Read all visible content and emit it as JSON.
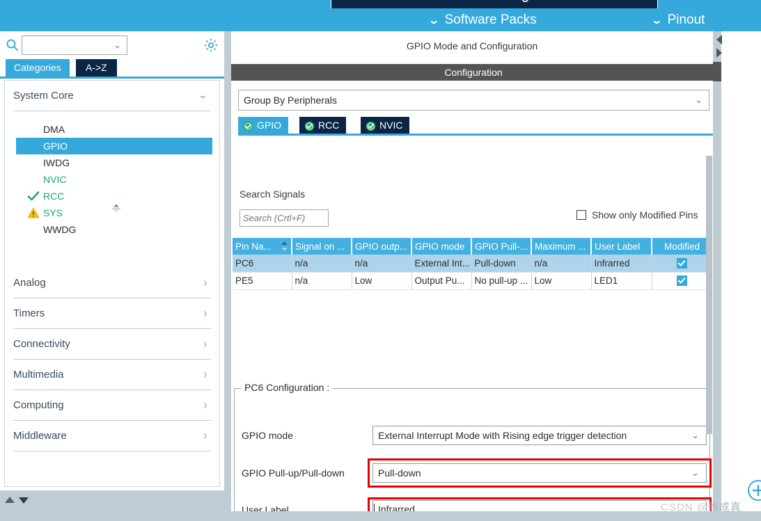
{
  "topnav": {
    "software_packs": "Software Packs",
    "pinout": "Pinout",
    "chevron": "⌄"
  },
  "left_panel": {
    "search": {
      "value": "",
      "placeholder": ""
    },
    "gear_tooltip": "Settings",
    "tabs": [
      {
        "id": "categories",
        "label": "Categories",
        "active": true
      },
      {
        "id": "a-to-z",
        "label": "A->Z",
        "active": false
      }
    ],
    "categories": [
      {
        "label": "System Core",
        "expanded": true,
        "arrow": "⌄"
      },
      {
        "label": "Analog",
        "expanded": false,
        "arrow": "›"
      },
      {
        "label": "Timers",
        "expanded": false,
        "arrow": "›"
      },
      {
        "label": "Connectivity",
        "expanded": false,
        "arrow": "›"
      },
      {
        "label": "Multimedia",
        "expanded": false,
        "arrow": "›"
      },
      {
        "label": "Computing",
        "expanded": false,
        "arrow": "›"
      },
      {
        "label": "Middleware",
        "expanded": false,
        "arrow": "›"
      }
    ],
    "system_core_items": [
      {
        "label": "DMA",
        "state": "none",
        "selected": false
      },
      {
        "label": "GPIO",
        "state": "none",
        "selected": true
      },
      {
        "label": "IWDG",
        "state": "none",
        "selected": false
      },
      {
        "label": "NVIC",
        "state": "green",
        "selected": false
      },
      {
        "label": "RCC",
        "state": "check",
        "selected": false
      },
      {
        "label": "SYS",
        "state": "warning",
        "selected": false
      },
      {
        "label": "WWDG",
        "state": "none",
        "selected": false
      }
    ]
  },
  "main": {
    "mode_title": "GPIO Mode and Configuration",
    "configuration_title": "Configuration",
    "group_by": {
      "value": "Group By Peripherals",
      "caret": "⌄"
    },
    "peripheral_tabs": [
      {
        "id": "gpio",
        "label": "GPIO",
        "active": true,
        "status": "ok"
      },
      {
        "id": "rcc",
        "label": "RCC",
        "active": false,
        "status": "ok"
      },
      {
        "id": "nvic",
        "label": "NVIC",
        "active": false,
        "status": "ok"
      }
    ],
    "search_signals_label": "Search Signals",
    "signal_search": {
      "value": "",
      "placeholder": "Search (Crtl+F)"
    },
    "show_modified": {
      "label": "Show only Modified Pins",
      "checked": false
    },
    "table": {
      "headers": [
        "Pin Na...",
        "Signal on ...",
        "GPIO outp...",
        "GPIO mode",
        "GPIO Pull-...",
        "Maximum ...",
        "User Label",
        "Modified"
      ],
      "rows": [
        {
          "selected": true,
          "cells": [
            "PC6",
            "n/a",
            "n/a",
            "External Int...",
            "Pull-down",
            "n/a",
            "Infrarred"
          ],
          "modified": true
        },
        {
          "selected": false,
          "cells": [
            "PE5",
            "n/a",
            "Low",
            "Output Pu...",
            "No pull-up ...",
            "Low",
            "LED1"
          ],
          "modified": true
        }
      ]
    },
    "pin_config": {
      "legend": "PC6 Configuration :",
      "fields": [
        {
          "label": "GPIO mode",
          "value": "External Interrupt Mode with Rising edge trigger detection",
          "type": "select",
          "highlighted": false
        },
        {
          "label": "GPIO Pull-up/Pull-down",
          "value": "Pull-down",
          "type": "select",
          "highlighted": true
        },
        {
          "label": "User Label",
          "value": "Infrarred",
          "type": "text",
          "highlighted": true
        }
      ],
      "caret": "⌄"
    }
  },
  "watermark": {
    "prefix": "CSDN @",
    "author": "修成真"
  },
  "colors": {
    "accent_blue": "#36a9dc",
    "dark_navy": "#0b2545",
    "table_header": "#44b0e0",
    "row_selected": "#aed4ec",
    "highlight_red": "#e60000",
    "config_header": "#545454",
    "green_ok": "#1ea37a",
    "warn_yellow": "#f2c21b"
  }
}
